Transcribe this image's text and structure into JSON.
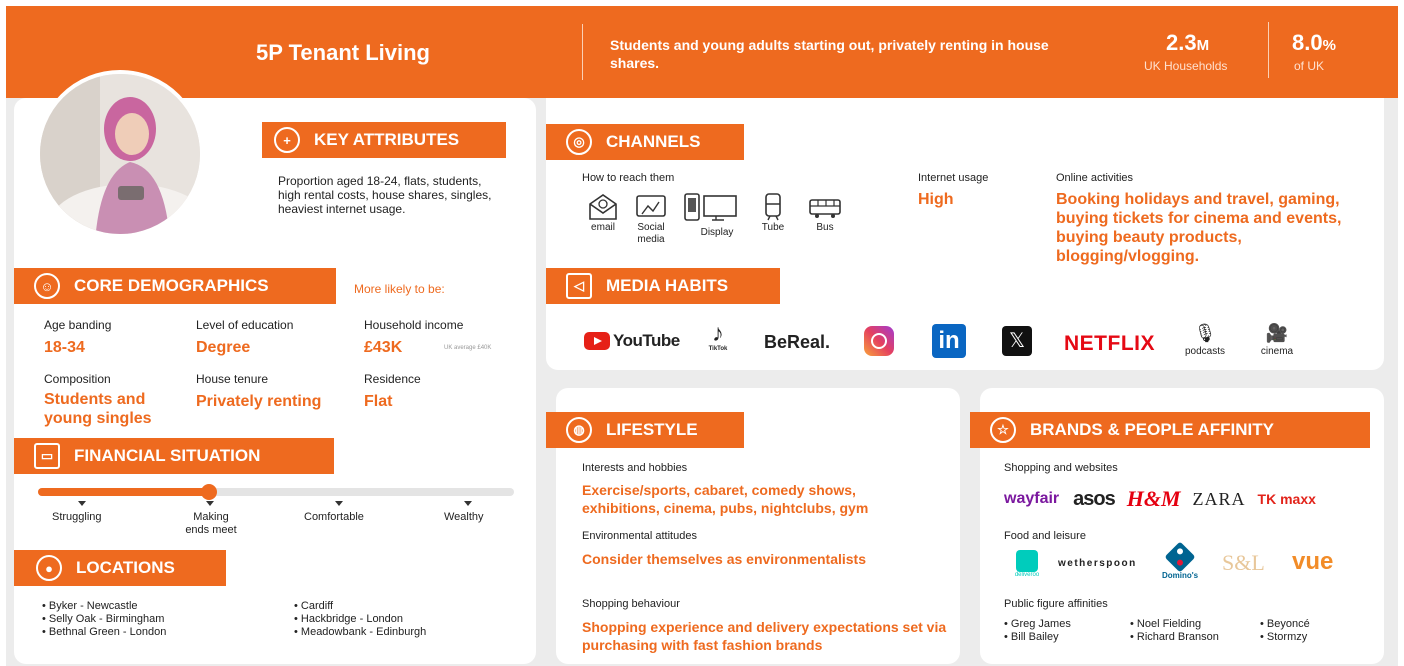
{
  "header": {
    "title": "5P Tenant Living",
    "description": "Students and young adults starting out, privately renting in house shares.",
    "stats": [
      {
        "value": "2.3",
        "unit": "M",
        "label": "UK Households"
      },
      {
        "value": "8.0",
        "unit": "%",
        "label": "of UK"
      }
    ]
  },
  "key_attributes": {
    "title": "KEY ATTRIBUTES",
    "text": "Proportion aged 18-24, flats, students, high rental costs, house shares, singles, heaviest internet usage."
  },
  "core_demographics": {
    "title": "CORE DEMOGRAPHICS",
    "more_likely": "More likely to be:",
    "age_label": "Age banding",
    "age_value": "18-34",
    "education_label": "Level of education",
    "education_value": "Degree",
    "income_label": "Household income",
    "income_value": "£43K",
    "income_note": "UK average £40K",
    "composition_label": "Composition",
    "composition_value": "Students and young singles",
    "tenure_label": "House tenure",
    "tenure_value": "Privately renting",
    "residence_label": "Residence",
    "residence_value": "Flat"
  },
  "financial": {
    "title": "FINANCIAL SITUATION",
    "level": 0.36,
    "labels": [
      "Struggling",
      "Making ends meet",
      "Comfortable",
      "Wealthy"
    ]
  },
  "locations": {
    "title": "LOCATIONS",
    "col1": [
      "• Byker - Newcastle",
      "• Selly Oak - Birmingham",
      "• Bethnal Green - London"
    ],
    "col2": [
      "• Cardiff",
      "• Hackbridge - London",
      "• Meadowbank - Edinburgh"
    ]
  },
  "channels": {
    "title": "CHANNELS",
    "reach_label": "How to reach them",
    "items": [
      {
        "icon": "email-icon",
        "label": "email"
      },
      {
        "icon": "social-media-icon",
        "label": "Social media"
      },
      {
        "icon": "display-icon",
        "label": "Display"
      },
      {
        "icon": "tube-icon",
        "label": "Tube"
      },
      {
        "icon": "bus-icon",
        "label": "Bus"
      }
    ],
    "internet_label": "Internet usage",
    "internet_value": "High",
    "online_label": "Online activities",
    "online_value": "Booking holidays and travel, gaming, buying tickets for cinema and events, buying beauty products, blogging/vlogging."
  },
  "media_habits": {
    "title": "MEDIA HABITS",
    "youtube": "YouTube",
    "tiktok": "TikTok",
    "bereal": "BeReal.",
    "linkedin": "in",
    "x": "𝕏",
    "netflix": "NETFLIX",
    "podcasts": "podcasts",
    "cinema": "cinema"
  },
  "lifestyle": {
    "title": "LIFESTYLE",
    "interests_label": "Interests and hobbies",
    "interests_value": "Exercise/sports, cabaret, comedy shows, exhibitions, cinema, pubs, nightclubs, gym",
    "env_label": "Environmental attitudes",
    "env_value": "Consider themselves as environmentalists",
    "shop_label": "Shopping behaviour",
    "shop_value": "Shopping experience and delivery expectations set via purchasing with fast fashion brands"
  },
  "brands": {
    "title": "BRANDS & PEOPLE AFFINITY",
    "shopping_label": "Shopping and websites",
    "wayfair": "wayfair",
    "asos": "asos",
    "hm": "H&M",
    "zara": "ZARA",
    "tkmaxx": "TK maxx",
    "food_label": "Food and leisure",
    "deliveroo": "deliveroo",
    "wetherspoon": "wetherspoon",
    "dominos": "Domino's",
    "sl": "S&L",
    "vue": "vue",
    "public_label": "Public figure affinities",
    "people_col1": [
      "• Greg James",
      "• Bill Bailey"
    ],
    "people_col2": [
      "• Noel Fielding",
      "• Richard Branson"
    ],
    "people_col3": [
      "• Beyoncé",
      "• Stormzy"
    ]
  },
  "colors": {
    "accent": "#ee6a1f"
  }
}
